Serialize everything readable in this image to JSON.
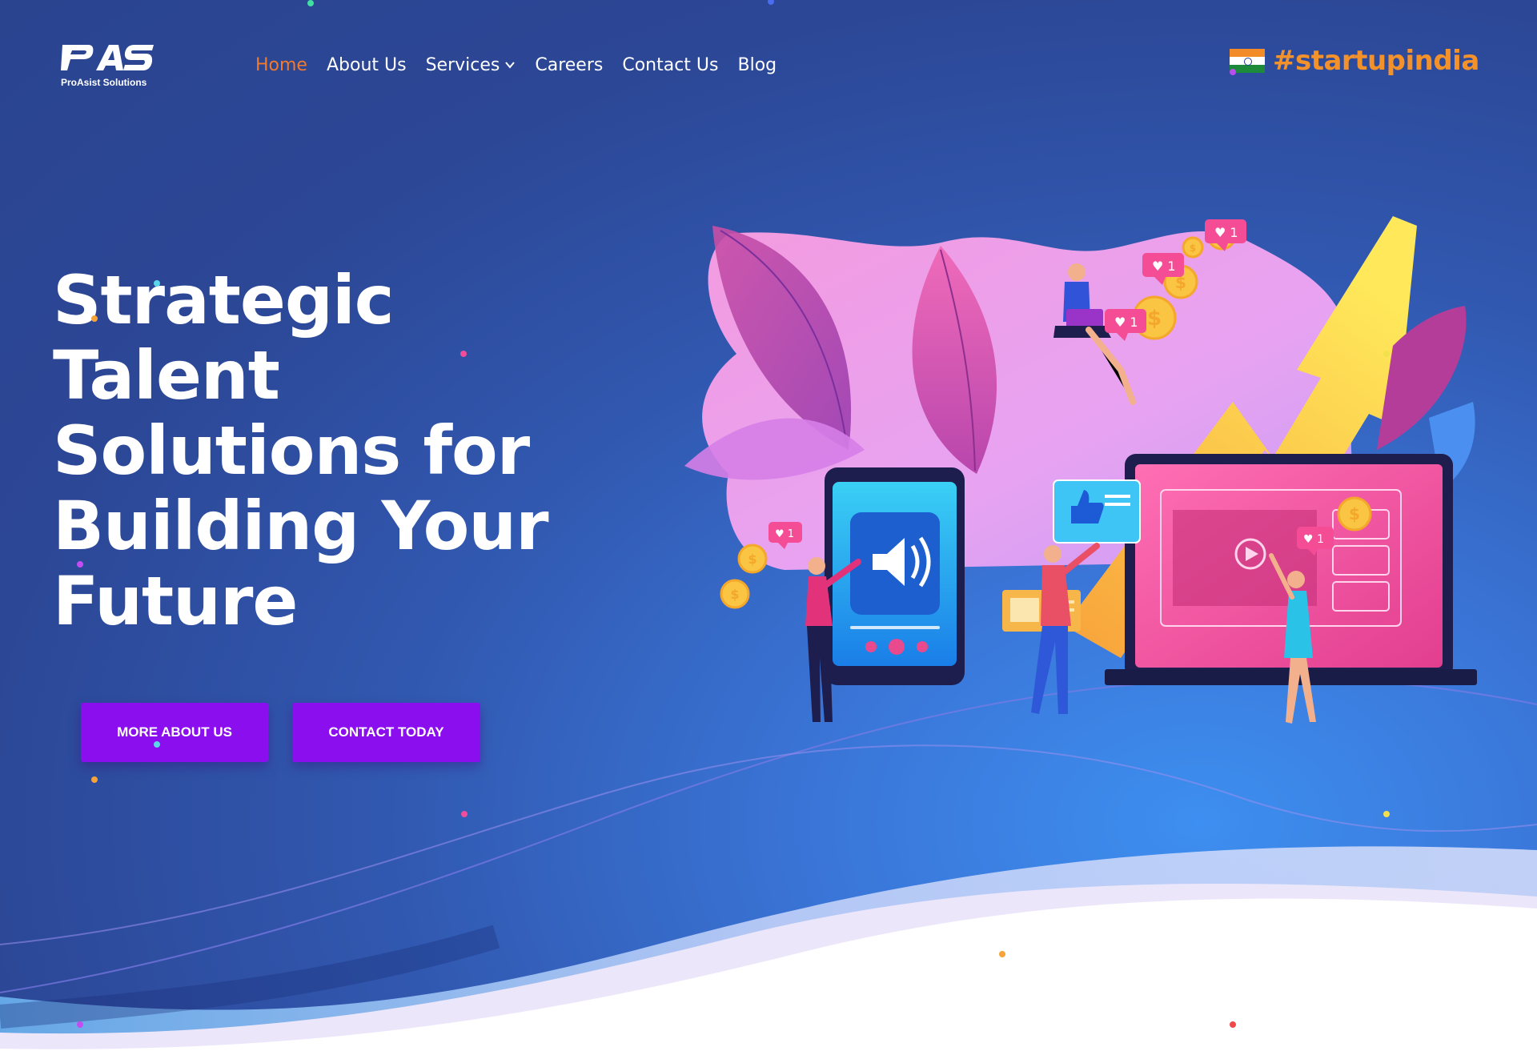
{
  "brand": {
    "logo_mark": "PAS",
    "logo_text": "ProAsist Solutions"
  },
  "nav": {
    "items": [
      {
        "label": "Home",
        "active": true
      },
      {
        "label": "About Us",
        "active": false
      },
      {
        "label": "Services",
        "active": false,
        "has_dropdown": true
      },
      {
        "label": "Careers",
        "active": false
      },
      {
        "label": "Contact Us",
        "active": false
      },
      {
        "label": "Blog",
        "active": false
      }
    ]
  },
  "badge": {
    "text": "#startupindia",
    "icon": "india-flag-icon"
  },
  "hero": {
    "headline_lines": [
      "Strategic Talent",
      "Solutions for",
      "Building Your",
      "Future"
    ],
    "buttons": {
      "more": "MORE ABOUT US",
      "contact": "CONTACT TODAY"
    },
    "like_count": "1"
  },
  "colors": {
    "background": "#2d4796",
    "accent_nav": "#f37a2a",
    "button": "#8b0eee",
    "badge": "#f3912b"
  }
}
